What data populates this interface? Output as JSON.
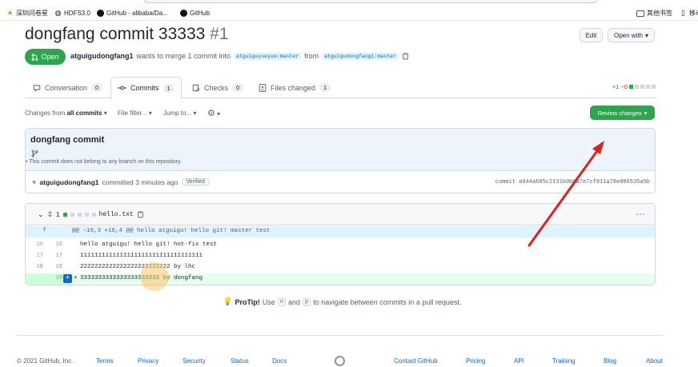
{
  "bookmarks": [
    {
      "label": "深圳问卷星",
      "icon": "star-icon"
    },
    {
      "label": "HDFS3.0",
      "icon": "globe-icon"
    },
    {
      "label": "GitHub - alibaba/Da...",
      "icon": "github-icon"
    },
    {
      "label": "GitHub",
      "icon": "github-icon"
    }
  ],
  "bookmarks_right": [
    {
      "label": "其他书签",
      "icon": "folder-icon"
    },
    {
      "label": "移动",
      "icon": "phone-icon"
    }
  ],
  "pr": {
    "title": "dongfang commit 33333",
    "number": "#1",
    "edit_label": "Edit",
    "open_with_label": "Open with",
    "state": "Open",
    "author": "atguigudongfang1",
    "merge_phrase": "wants to merge 1 commit into",
    "base_branch": "atguiguyueyue:master",
    "from_word": "from",
    "head_branch": "atguigudongfang1:master"
  },
  "tabs": [
    {
      "label": "Conversation",
      "count": "0",
      "icon": "comment-icon"
    },
    {
      "label": "Commits",
      "count": "1",
      "icon": "commit-icon"
    },
    {
      "label": "Checks",
      "count": "0",
      "icon": "checklist-icon"
    },
    {
      "label": "Files changed",
      "count": "1",
      "icon": "file-diff-icon"
    }
  ],
  "diffstat": {
    "added": "+1",
    "removed": "−0"
  },
  "toolbar": {
    "changes_prefix": "Changes from",
    "changes_value": "all commits",
    "file_filter": "File filter...",
    "jump_to": "Jump to...",
    "review_label": "Review changes"
  },
  "commit": {
    "title": "dongfang commit",
    "note": "This commit does not belong to any branch on this repository.",
    "author": "atguigudongfang1",
    "committed_text": "committed 3 minutes ago",
    "verified": "Verified",
    "sha_label": "commit a944a685c2131b0b0a7e7cf911a78e886535a5b"
  },
  "diff": {
    "count": "1",
    "filename": "hello.txt",
    "hunk": "@@ -16,3 +16,4 @@ hello atguigu! hello git! master test",
    "lines": [
      {
        "old": "16",
        "new": "16",
        "sign": "",
        "text": "hello atguigu! hello git! hot-fix test"
      },
      {
        "old": "17",
        "new": "17",
        "sign": "",
        "text": "1111111111111111111111111111111111"
      },
      {
        "old": "18",
        "new": "18",
        "sign": "",
        "text": "2222222222222222222222222 by lhc"
      },
      {
        "old": "",
        "new": "19",
        "sign": "+",
        "text": "3333333333333333333333 by dongfang"
      }
    ]
  },
  "protip": {
    "lead": "ProTip!",
    "text1": "Use",
    "key1": "n",
    "text2": "and",
    "key2": "p",
    "text3": "to navigate between commits in a pull request."
  },
  "footer": {
    "copyright": "© 2021 GitHub, Inc.",
    "links": [
      "Terms",
      "Privacy",
      "Security",
      "Status",
      "Docs",
      "Contact GitHub",
      "Pricing",
      "API",
      "Training",
      "Blog",
      "About"
    ]
  },
  "colors": {
    "accent_green": "#2da44e",
    "link_blue": "#0969da",
    "annotation_arrow": "#e02020"
  }
}
